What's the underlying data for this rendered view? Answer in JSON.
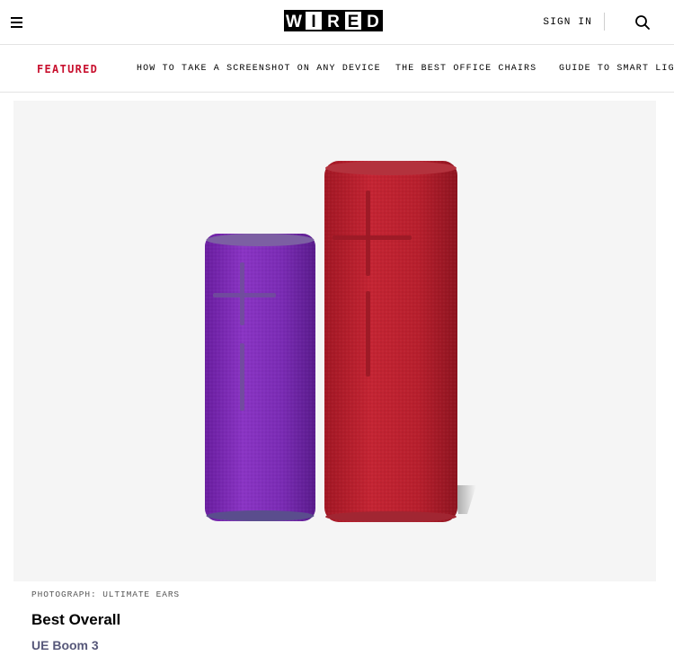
{
  "header": {
    "logo_letters": [
      "W",
      "I",
      "R",
      "E",
      "D"
    ],
    "sign_in_label": "SIGN IN"
  },
  "featured": {
    "label": "FEATURED",
    "links": [
      "HOW TO TAKE A SCREENSHOT ON ANY DEVICE",
      "THE BEST OFFICE CHAIRS",
      "GUIDE TO SMART LIGHTS"
    ]
  },
  "hero": {
    "credit": "PHOTOGRAPH: ULTIMATE EARS",
    "speakers": [
      {
        "color": "#7b2bb0"
      },
      {
        "color": "#b01e2a"
      }
    ]
  },
  "product": {
    "heading": "Best Overall",
    "name": "UE Boom 3"
  },
  "colors": {
    "accent": "#c8102e",
    "product_link": "#57587a"
  },
  "icons": {
    "menu": "hamburger-menu-icon",
    "search": "search-icon"
  }
}
